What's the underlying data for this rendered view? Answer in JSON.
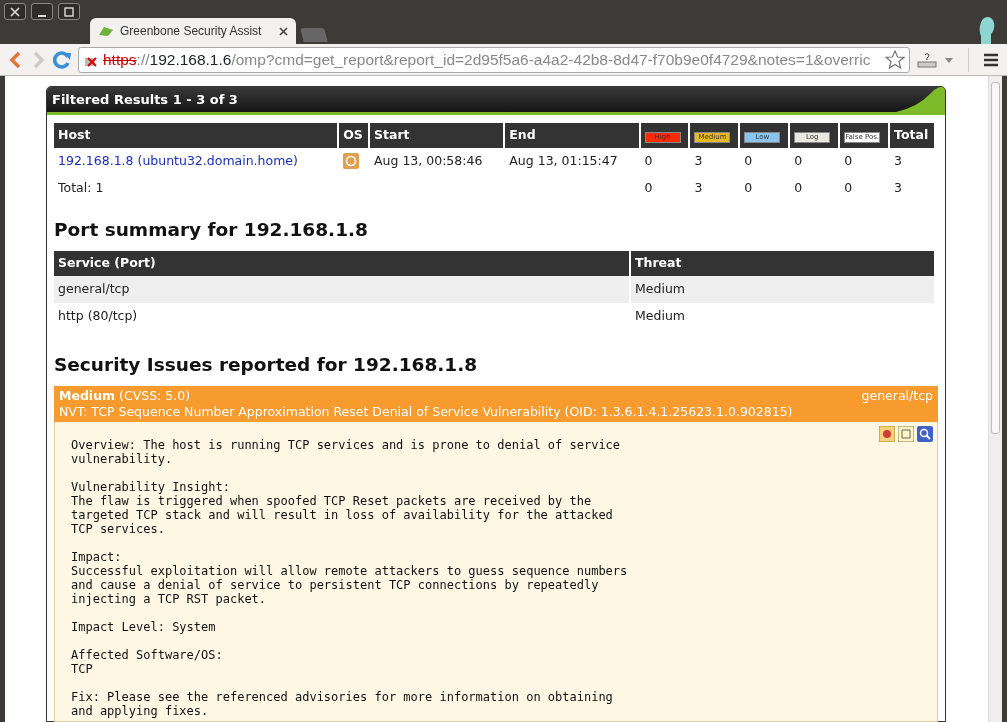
{
  "browser": {
    "tab_title": "Greenbone Security Assist",
    "url": {
      "scheme": "https",
      "separator": "://",
      "host": "192.168.1.6",
      "path": "/omp?cmd=get_report&report_id=2d95f5a6-a4a2-42b8-8d47-f70b9e0f4729&notes=1&overric"
    }
  },
  "panel": {
    "title": "Filtered Results 1 - 3 of 3"
  },
  "hosts_table": {
    "columns": [
      {
        "kind": "text",
        "label": "Host"
      },
      {
        "kind": "text",
        "label": "OS"
      },
      {
        "kind": "text",
        "label": "Start"
      },
      {
        "kind": "text",
        "label": "End"
      },
      {
        "kind": "badge",
        "label": "High",
        "color": "#ff2a00"
      },
      {
        "kind": "badge",
        "label": "Medium",
        "color": "#e8b820"
      },
      {
        "kind": "badge",
        "label": "Low",
        "color": "#88c4ee"
      },
      {
        "kind": "badge",
        "label": "Log",
        "color": "#e8e8e0"
      },
      {
        "kind": "badge",
        "label": "False Pos.",
        "color": "#ffffff"
      },
      {
        "kind": "text",
        "label": "Total"
      }
    ],
    "rows": [
      {
        "host": "192.168.1.8 (ubuntu32.domain.home)",
        "start": "Aug 13, 00:58:46",
        "end": "Aug 13, 01:15:47",
        "counts": [
          "0",
          "3",
          "0",
          "0",
          "0",
          "3"
        ]
      }
    ],
    "total": {
      "label": "Total: 1",
      "counts": [
        "0",
        "3",
        "0",
        "0",
        "0",
        "3"
      ]
    }
  },
  "port_summary": {
    "heading": "Port summary for 192.168.1.8",
    "columns": [
      "Service (Port)",
      "Threat"
    ],
    "rows": [
      {
        "service": "general/tcp",
        "threat": "Medium",
        "selected": true
      },
      {
        "service": "http (80/tcp)",
        "threat": "Medium",
        "selected": false
      }
    ]
  },
  "security_issues": {
    "heading": "Security Issues reported for 192.168.1.8",
    "issues": [
      {
        "severity": "Medium",
        "cvss": "(CVSS: 5.0)",
        "port": "general/tcp",
        "nvt": "NVT: TCP Sequence Number Approximation Reset Denial of Service Vulnerability (OID: 1.3.6.1.4.1.25623.1.0.902815)",
        "color": "#f89b2e",
        "paragraphs": [
          [
            "Overview: The host is running TCP services and is prone to denial of service",
            "vulnerability."
          ],
          [
            "Vulnerability Insight:",
            "The flaw is triggered when spoofed TCP Reset packets are received by the",
            "targeted TCP stack and will result in loss of availability for the attacked",
            "TCP services."
          ],
          [
            "Impact:",
            "Successful exploitation will allow remote attackers to guess sequence numbers",
            "and cause a denial of service to persistent TCP connections by repeatedly",
            "injecting a TCP RST packet."
          ],
          [
            "Impact Level: System"
          ],
          [
            "Affected Software/OS:",
            "TCP"
          ],
          [
            "Fix: Please see the referenced advisories for more information on obtaining",
            "and applying fixes."
          ]
        ]
      }
    ]
  }
}
